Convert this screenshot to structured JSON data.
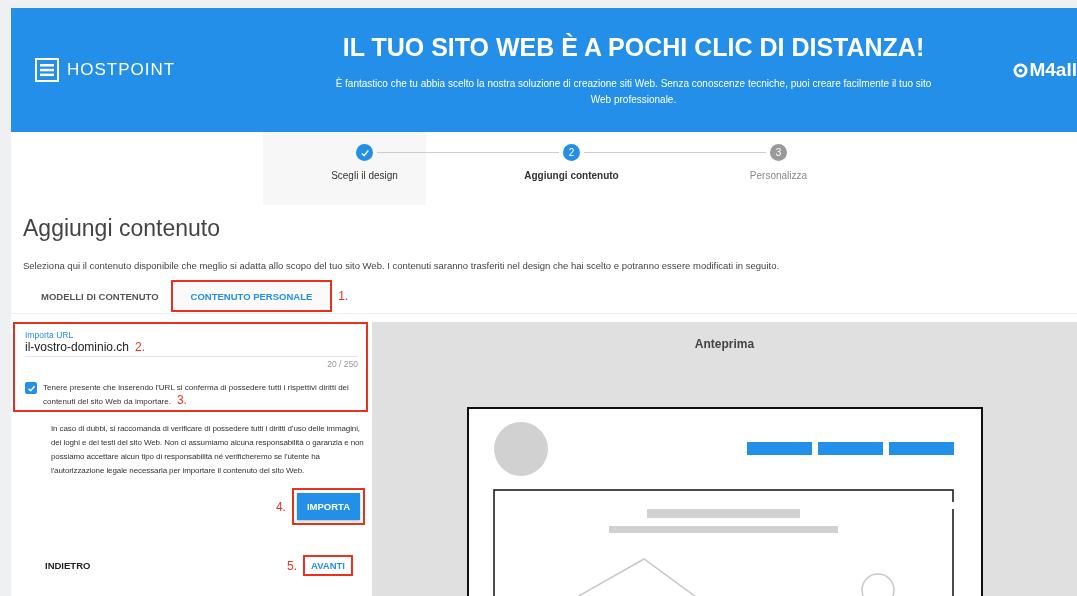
{
  "header": {
    "logo": "HOSTPOINT",
    "title": "IL TUO SITO WEB È A POCHI CLIC DI DISTANZA!",
    "subtitle": "È fantastico che tu abbia scelto la nostra soluzione di creazione siti Web. Senza conoscenze tecniche, puoi creare facilmente il tuo sito Web professionale.",
    "partner_logo": "M4all"
  },
  "steps": [
    {
      "label": "Scegli il design",
      "completed": true,
      "selected": false
    },
    {
      "number": "2",
      "label": "Aggiungi contenuto",
      "completed": false,
      "selected": true
    },
    {
      "number": "3",
      "label": "Personalizza",
      "completed": false,
      "selected": false
    }
  ],
  "page_title": "Aggiungi contenuto",
  "description": "Seleziona qui il contenuto disponibile che meglio si adatta allo scopo del tuo sito Web. I contenuti saranno trasferiti nel design che hai scelto e potranno essere modificati in seguito.",
  "tabs": [
    {
      "label": "MODELLI DI CONTENUTO",
      "selected": false
    },
    {
      "label": "CONTENUTO PERSONALE",
      "selected": true,
      "marker": "1."
    }
  ],
  "url_field": {
    "label": "Importa URL",
    "value": "il-vostro-dominio.ch",
    "marker": "2.",
    "counter": "20 / 250"
  },
  "consent": {
    "checked": true,
    "text": "Tenere presente che inserendo l'URL si conferma di possedere tutti i rispettivi diritti dei contenuti del sito Web da importare.",
    "marker": "3."
  },
  "disclaimer": "In caso di dubbi, si raccomanda di verificare di possedere tutti i diritti d'uso delle immagini, dei loghi e dei testi del sito Web. Non ci assumiamo alcuna responsabilità o garanzia e non possiamo accettare alcun tipo di responsabilità né verificheremo se l'utente ha l'autorizzazione legale necessaria per importare il contenuto del sito Web.",
  "import_button": {
    "label": "IMPORTA",
    "marker": "4."
  },
  "back_button": {
    "label": "INDIETRO"
  },
  "next_button": {
    "label": "AVANTI",
    "marker": "5."
  },
  "preview": {
    "title": "Anteprima"
  }
}
